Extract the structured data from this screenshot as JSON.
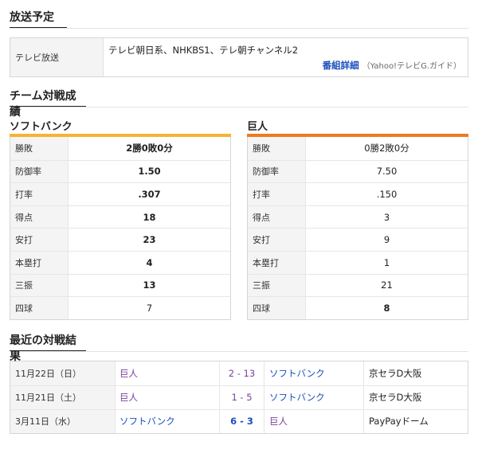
{
  "broadcast": {
    "title": "放送予定",
    "label": "テレビ放送",
    "channels": "テレビ朝日系、NHKBS1、テレ朝チャンネル2",
    "guide_link": "番組詳細",
    "guide_source": "（Yahoo!テレビG.ガイド）"
  },
  "matchup": {
    "title": "チーム対戦成績",
    "teams": [
      {
        "name": "ソフトバンク",
        "color": "#f5b335",
        "stats": [
          {
            "label": "勝敗",
            "value": "2勝0敗0分"
          },
          {
            "label": "防御率",
            "value": "1.50"
          },
          {
            "label": "打率",
            "value": ".307"
          },
          {
            "label": "得点",
            "value": "18"
          },
          {
            "label": "安打",
            "value": "23"
          },
          {
            "label": "本塁打",
            "value": "4"
          },
          {
            "label": "三振",
            "value": "13"
          },
          {
            "label": "四球",
            "value": "7"
          }
        ]
      },
      {
        "name": "巨人",
        "color": "#ee7a22",
        "stats": [
          {
            "label": "勝敗",
            "value": "0勝2敗0分"
          },
          {
            "label": "防御率",
            "value": "7.50"
          },
          {
            "label": "打率",
            "value": ".150"
          },
          {
            "label": "得点",
            "value": "3"
          },
          {
            "label": "安打",
            "value": "9"
          },
          {
            "label": "本塁打",
            "value": "1"
          },
          {
            "label": "三振",
            "value": "21"
          },
          {
            "label": "四球",
            "value": "8"
          }
        ]
      }
    ]
  },
  "recent": {
    "title": "最近の対戦結果",
    "games": [
      {
        "date": "11月22日（日）",
        "home": "巨人",
        "score": "2 - 13",
        "away": "ソフトバンク",
        "venue": "京セラD大阪"
      },
      {
        "date": "11月21日（土）",
        "home": "巨人",
        "score": "1 - 5",
        "away": "ソフトバンク",
        "venue": "京セラD大阪"
      },
      {
        "date": "3月11日（水）",
        "home": "ソフトバンク",
        "score": "6 - 3",
        "away": "巨人",
        "venue": "PayPayドーム"
      }
    ]
  }
}
